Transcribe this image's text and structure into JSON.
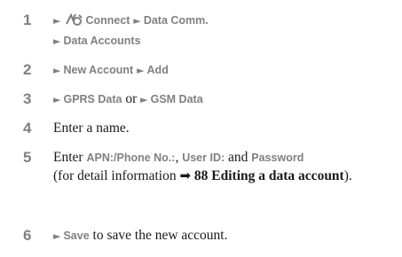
{
  "steps": [
    {
      "number": "1",
      "arrow": "►",
      "icon": "connect-icon",
      "line1_a": "Connect",
      "line1_b": "Data Comm.",
      "line2": "Data Accounts"
    },
    {
      "number": "2",
      "arrow": "►",
      "part_a": "New Account",
      "part_b": "Add"
    },
    {
      "number": "3",
      "arrow": "►",
      "part_a": "GPRS Data",
      "or": "or",
      "part_b": "GSM Data"
    },
    {
      "number": "4",
      "text": "Enter a name."
    },
    {
      "number": "5",
      "enter": "Enter",
      "apn": "APN:/Phone No.:",
      "sep": ",",
      "user_id": "User ID:",
      "and": "and",
      "password": "Password",
      "paren_open": "(for detail information",
      "ref_arrow": "➡",
      "ref_text": "88 Editing a data account",
      "paren_close": ")."
    },
    {
      "number": "6",
      "arrow": "►",
      "save": "Save",
      "rest": "to save the new account."
    }
  ]
}
